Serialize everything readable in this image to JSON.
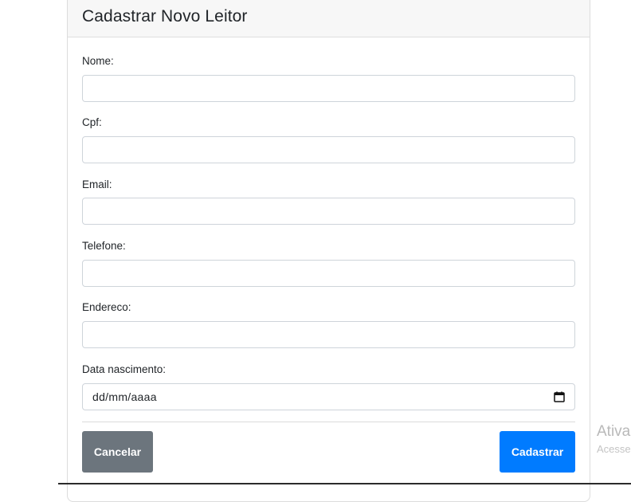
{
  "form": {
    "title": "Cadastrar Novo Leitor",
    "fields": [
      {
        "label": "Nome:",
        "value": "",
        "placeholder": ""
      },
      {
        "label": "Cpf:",
        "value": "",
        "placeholder": ""
      },
      {
        "label": "Email:",
        "value": "",
        "placeholder": ""
      },
      {
        "label": "Telefone:",
        "value": "",
        "placeholder": ""
      },
      {
        "label": "Endereco:",
        "value": "",
        "placeholder": ""
      },
      {
        "label": "Data nascimento:",
        "value": "dd/mm/aaaa",
        "icon": "calendar-icon"
      }
    ],
    "cancel_label": "Cancelar",
    "submit_label": "Cadastrar"
  },
  "watermark": {
    "title": "Ativa",
    "subtitle": "Acesse"
  },
  "colors": {
    "cancel": "#6c757d",
    "submit": "#007bff"
  }
}
